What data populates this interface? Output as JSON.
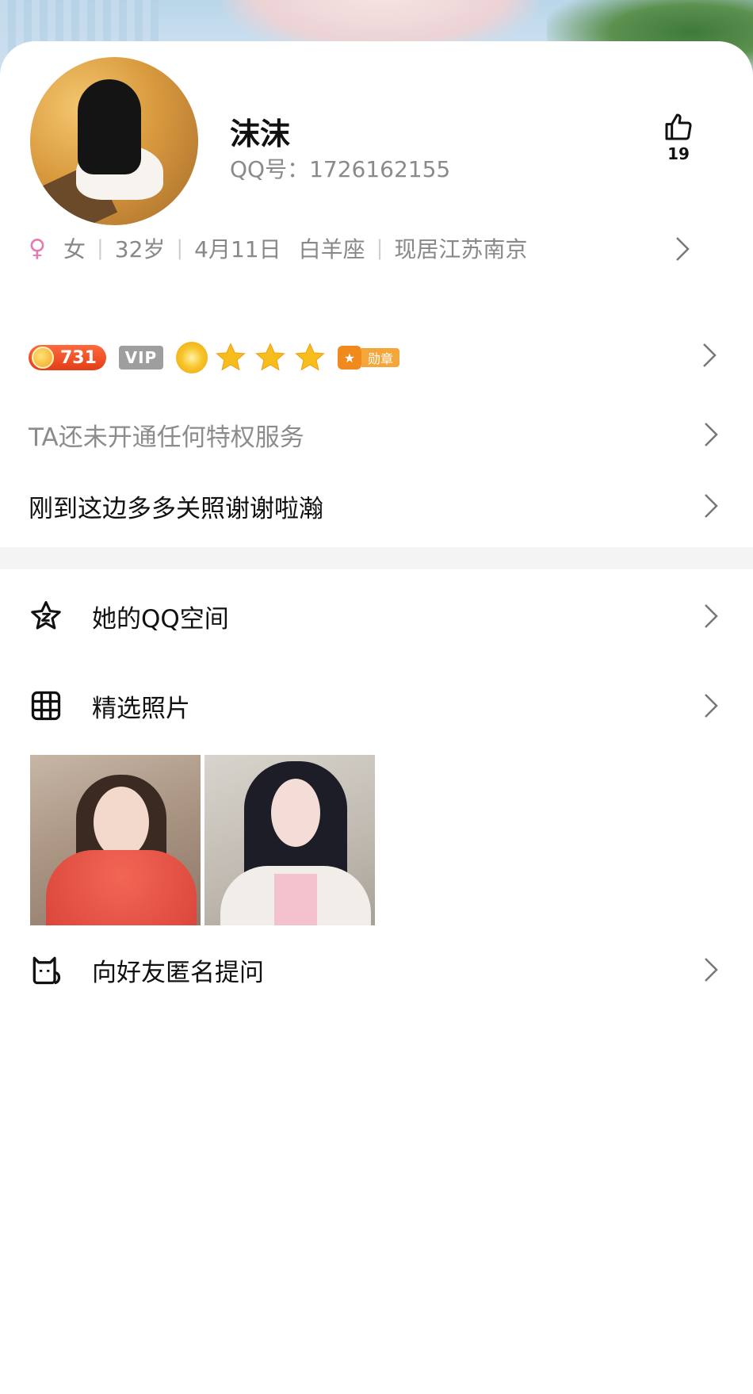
{
  "profile": {
    "name": "沫沫",
    "qq_number": "QQ号：1726162155",
    "likes": "19"
  },
  "info": {
    "gender_symbol": "♀",
    "gender": "女",
    "age": "32岁",
    "birthday": "4月11日",
    "zodiac": "白羊座",
    "location": "现居江苏南京",
    "separator": "|"
  },
  "badges": {
    "coin_level": "731",
    "vip_label": "VIP",
    "medal_label": "勋章",
    "stars": 3
  },
  "privilege_text": "TA还未开通任何特权服务",
  "signature": "刚到这边多多关照谢谢啦瀚",
  "menu": {
    "qzone_label": "她的QQ空间",
    "photos_label": "精选照片",
    "ask_label": "向好友匿名提问"
  },
  "colors": {
    "gender": "#e37bb0",
    "coin_badge": "#e23d17",
    "vip_badge": "#9e9e9e",
    "medal": "#f08a1c",
    "text_primary": "#111111",
    "text_secondary": "#888888"
  }
}
